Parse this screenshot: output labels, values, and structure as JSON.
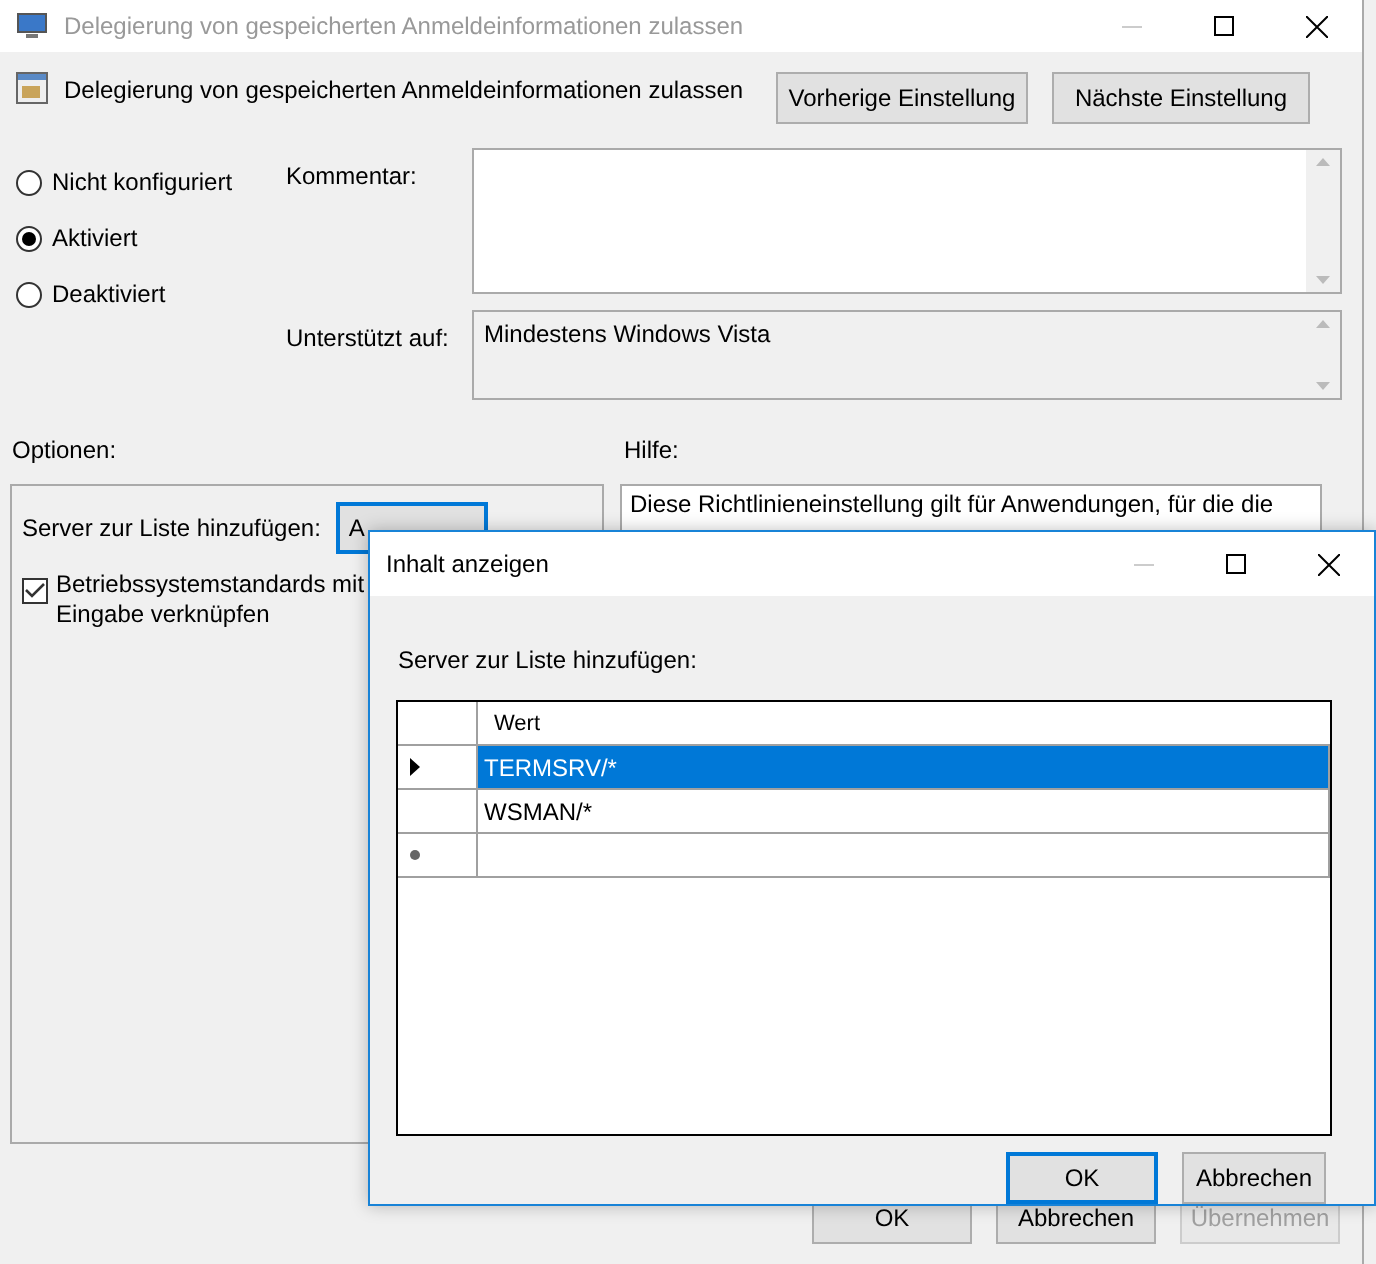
{
  "window": {
    "title": "Delegierung von gespeicherten Anmeldeinformationen zulassen"
  },
  "header": {
    "setting_title": "Delegierung von gespeicherten Anmeldeinformationen zulassen",
    "buttons": [
      {
        "label": "Vorherige Einstellung"
      },
      {
        "label": "Nächste Einstellung"
      }
    ]
  },
  "state_options": [
    {
      "label": "Nicht konfiguriert",
      "selected": false
    },
    {
      "label": "Aktiviert",
      "selected": true
    },
    {
      "label": "Deaktiviert",
      "selected": false
    }
  ],
  "comment": {
    "label": "Kommentar:"
  },
  "supported": {
    "label": "Unterstützt auf:",
    "value": "Mindestens Windows Vista"
  },
  "options": {
    "heading": "Optionen:",
    "server_label": "Server zur Liste hinzufügen:",
    "show_button": "A",
    "checkbox": {
      "lines": [
        "Betriebssystemstandards mit",
        "Eingabe verknüpfen"
      ],
      "checked": true
    }
  },
  "help": {
    "heading": "Hilfe:",
    "text": "Diese Richtlinieneinstellung gilt für Anwendungen, für die die"
  },
  "buttons": [
    {
      "label": "OK",
      "disabled": false
    },
    {
      "label": "Abbrechen",
      "disabled": false
    },
    {
      "label": "Übernehmen",
      "disabled": true
    }
  ],
  "dialog": {
    "title": "Inhalt anzeigen",
    "label": "Server zur Liste hinzufügen:",
    "column": "Wert",
    "rows": [
      {
        "value": "TERMSRV/*",
        "selected": true
      },
      {
        "value": "WSMAN/*",
        "selected": false
      }
    ],
    "buttons": [
      {
        "label": "OK",
        "default": true
      },
      {
        "label": "Abbrechen",
        "default": false
      }
    ]
  }
}
